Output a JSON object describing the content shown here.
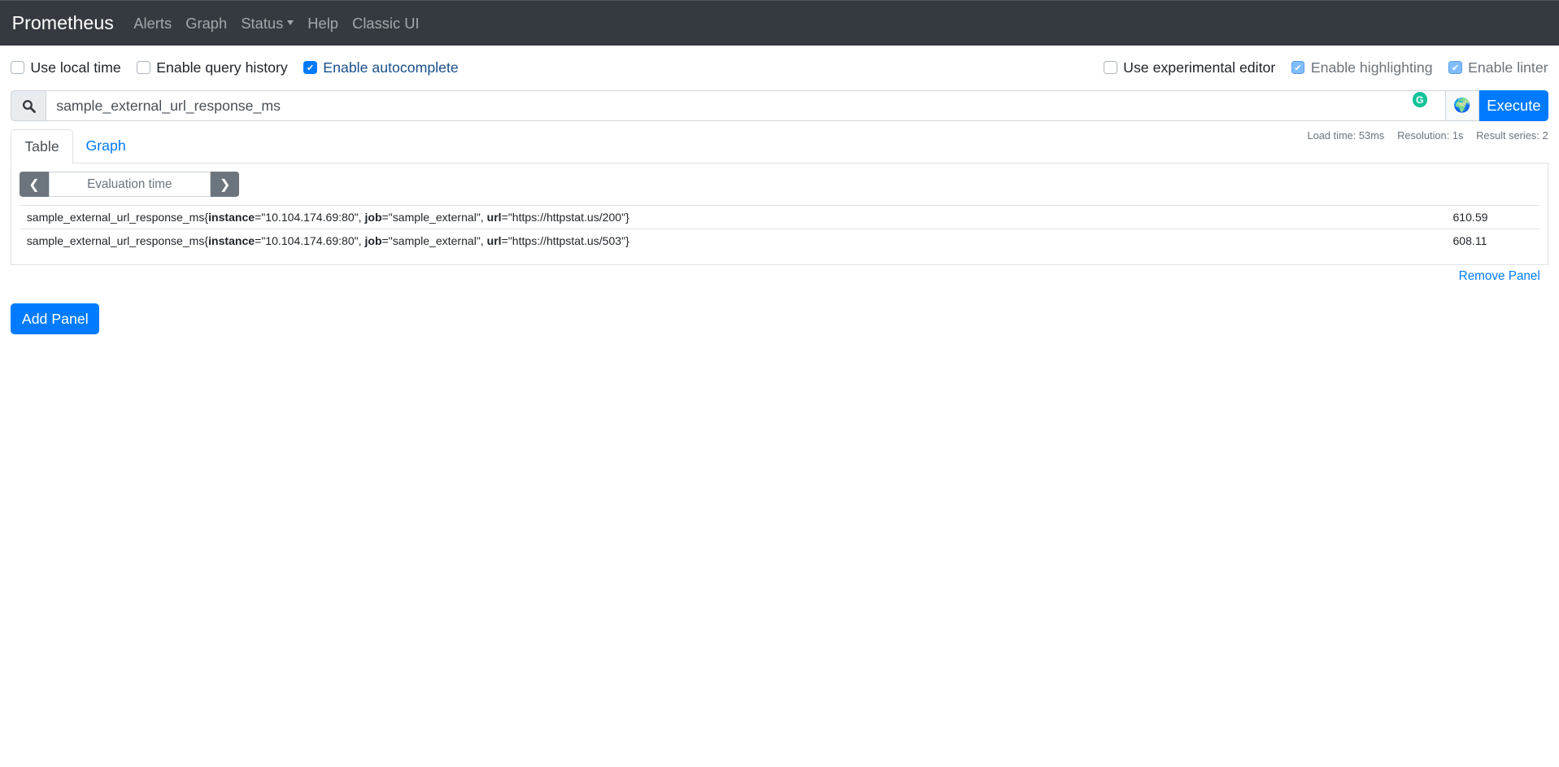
{
  "navbar": {
    "brand": "Prometheus",
    "items": [
      "Alerts",
      "Graph",
      "Status",
      "Help",
      "Classic UI"
    ]
  },
  "options": {
    "left": [
      {
        "label": "Use local time",
        "checked": false
      },
      {
        "label": "Enable query history",
        "checked": false
      },
      {
        "label": "Enable autocomplete",
        "checked": true
      }
    ],
    "right": [
      {
        "label": "Use experimental editor",
        "checked": false
      },
      {
        "label": "Enable highlighting",
        "checked": true
      },
      {
        "label": "Enable linter",
        "checked": true
      }
    ]
  },
  "query": {
    "value": "sample_external_url_response_ms",
    "execute_label": "Execute",
    "grammarly_badge": "G"
  },
  "stats": {
    "load_time": "Load time: 53ms",
    "resolution": "Resolution: 1s",
    "result_series": "Result series: 2"
  },
  "tabs": [
    "Table",
    "Graph"
  ],
  "eval": {
    "placeholder": "Evaluation time"
  },
  "results": [
    {
      "metric": "sample_external_url_response_ms",
      "labels": [
        {
          "k": "instance",
          "v": "\"10.104.174.69:80\""
        },
        {
          "k": "job",
          "v": "\"sample_external\""
        },
        {
          "k": "url",
          "v": "\"https://httpstat.us/200\""
        }
      ],
      "value": "610.59"
    },
    {
      "metric": "sample_external_url_response_ms",
      "labels": [
        {
          "k": "instance",
          "v": "\"10.104.174.69:80\""
        },
        {
          "k": "job",
          "v": "\"sample_external\""
        },
        {
          "k": "url",
          "v": "\"https://httpstat.us/503\""
        }
      ],
      "value": "608.11"
    }
  ],
  "remove_panel": "Remove Panel",
  "add_panel": "Add Panel"
}
